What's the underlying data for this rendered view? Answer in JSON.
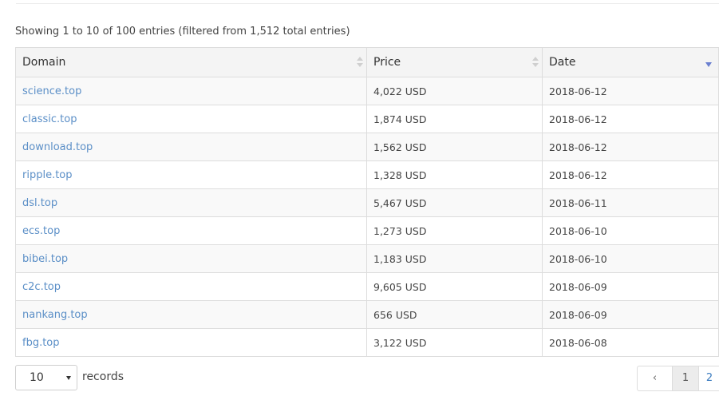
{
  "info_text": "Showing 1 to 10 of 100 entries (filtered from 1,512 total entries)",
  "columns": {
    "domain": "Domain",
    "price": "Price",
    "date": "Date"
  },
  "rows": [
    {
      "domain": "science.top",
      "price": "4,022 USD",
      "date": "2018-06-12"
    },
    {
      "domain": "classic.top",
      "price": "1,874 USD",
      "date": "2018-06-12"
    },
    {
      "domain": "download.top",
      "price": "1,562 USD",
      "date": "2018-06-12"
    },
    {
      "domain": "ripple.top",
      "price": "1,328 USD",
      "date": "2018-06-12"
    },
    {
      "domain": "dsl.top",
      "price": "5,467 USD",
      "date": "2018-06-11"
    },
    {
      "domain": "ecs.top",
      "price": "1,273 USD",
      "date": "2018-06-10"
    },
    {
      "domain": "bibei.top",
      "price": "1,183 USD",
      "date": "2018-06-10"
    },
    {
      "domain": "c2c.top",
      "price": "9,605 USD",
      "date": "2018-06-09"
    },
    {
      "domain": "nankang.top",
      "price": "656 USD",
      "date": "2018-06-09"
    },
    {
      "domain": "fbg.top",
      "price": "3,122 USD",
      "date": "2018-06-08"
    }
  ],
  "page_size": {
    "selected": "10",
    "label": "records"
  },
  "pagination": {
    "prev": "‹",
    "current": "1",
    "next_page": "2"
  },
  "colors": {
    "link": "#5b8fc7",
    "sort_active": "#6a7fd0",
    "header_bg": "#f4f4f4"
  },
  "icons": {
    "sort_both": "sort-both-icon",
    "sort_desc": "sort-desc-icon",
    "dropdown": "chevron-down-icon"
  }
}
